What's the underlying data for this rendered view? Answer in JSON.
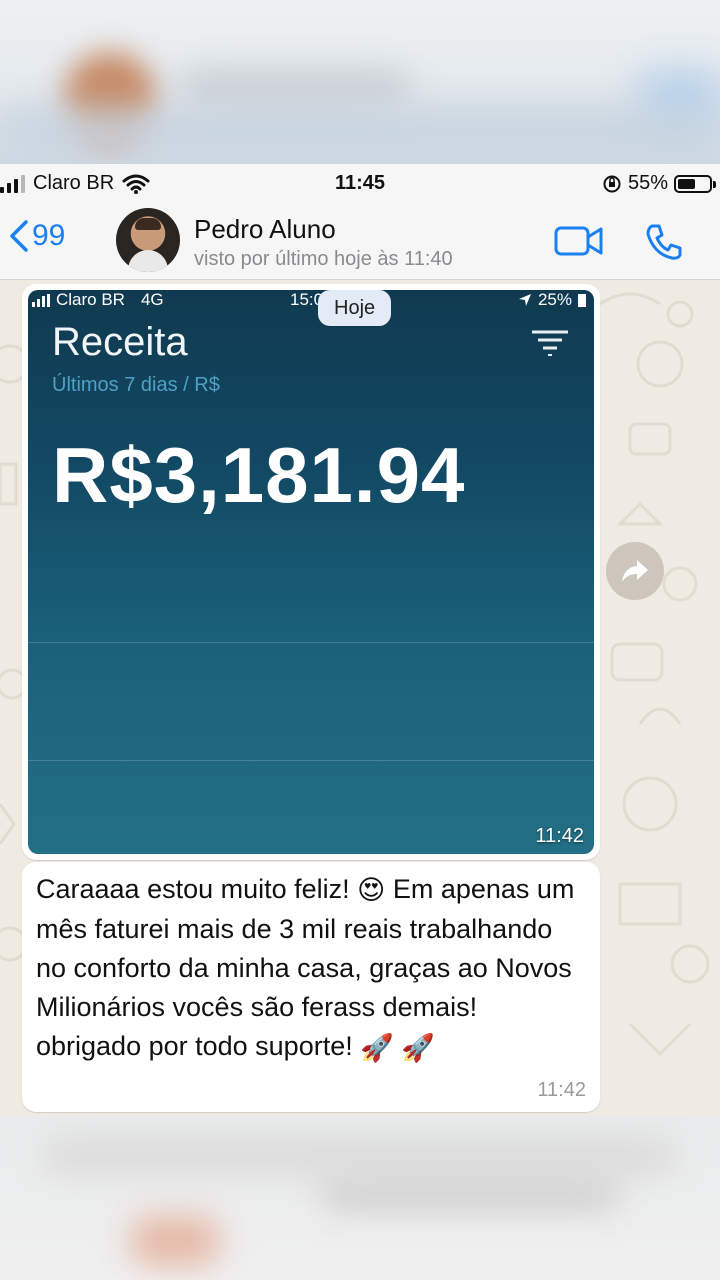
{
  "status_bar": {
    "carrier": "Claro BR",
    "time": "11:45",
    "battery": "55%",
    "battery_level": 0.55
  },
  "header": {
    "back_count": "99",
    "contact_name": "Pedro Aluno",
    "last_seen": "visto por último hoje às 11:40"
  },
  "chat": {
    "date_label": "Hoje",
    "image_message": {
      "timestamp": "11:42",
      "screenshot": {
        "carrier": "Claro BR",
        "network": "4G",
        "time": "15:0",
        "battery": "25%",
        "title": "Receita",
        "subtitle": "Últimos 7 dias / R$",
        "amount": "R$3,181.94"
      }
    },
    "text_message": {
      "text_part1": "Caraaaa estou muito feliz! ",
      "emoji1": "😍",
      "text_part2": " Em apenas um mês faturei mais de 3 mil reais trabalhando no conforto da minha casa, graças ao Novos Milionários vocês são ferass demais!  obrigado por todo suporte! ",
      "emoji2": "🚀",
      "emoji3": "🚀",
      "timestamp": "11:42"
    }
  },
  "colors": {
    "accent_blue": "#1a7ff0",
    "chat_background": "#efeae2",
    "bubble": "#ffffff"
  }
}
